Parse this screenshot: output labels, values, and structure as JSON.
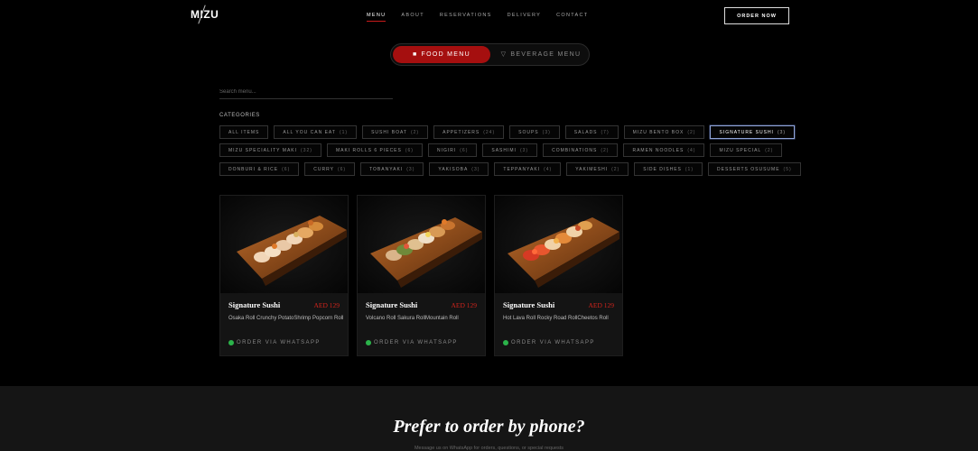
{
  "brand": {
    "logo": "MIZU"
  },
  "nav": {
    "items": [
      "MENU",
      "ABOUT",
      "RESERVATIONS",
      "DELIVERY",
      "CONTACT"
    ],
    "active": "MENU",
    "order_now": "ORDER NOW"
  },
  "menu_toggle": {
    "food_label": "FOOD MENU",
    "beverage_label": "BEVERAGE MENU",
    "active": "FOOD MENU"
  },
  "search": {
    "placeholder": "Search menu...",
    "value": ""
  },
  "categories": {
    "title": "CATEGORIES",
    "rows": [
      [
        {
          "label": "ALL ITEMS",
          "count": ""
        },
        {
          "label": "ALL YOU CAN EAT",
          "count": "(1)"
        },
        {
          "label": "SUSHI BOAT",
          "count": "(2)"
        },
        {
          "label": "APPETIZERS",
          "count": "(24)"
        },
        {
          "label": "SOUPS",
          "count": "(3)"
        },
        {
          "label": "SALADS",
          "count": "(7)"
        },
        {
          "label": "MIZU BENTO BOX",
          "count": "(2)"
        },
        {
          "label": "SIGNATURE SUSHI",
          "count": "(3)"
        }
      ],
      [
        {
          "label": "MIZU SPECIALITY MAKI",
          "count": "(32)"
        },
        {
          "label": "MAKI ROLLS 6 PIECES",
          "count": "(6)"
        },
        {
          "label": "NIGIRI",
          "count": "(6)"
        },
        {
          "label": "SASHIMI",
          "count": "(3)"
        },
        {
          "label": "COMBINATIONS",
          "count": "(2)"
        },
        {
          "label": "RAMEN NOODLES",
          "count": "(4)"
        },
        {
          "label": "MIZU SPECIAL",
          "count": "(2)"
        }
      ],
      [
        {
          "label": "DONBURI & RICE",
          "count": "(6)"
        },
        {
          "label": "CURRY",
          "count": "(6)"
        },
        {
          "label": "TOBANYAKI",
          "count": "(3)"
        },
        {
          "label": "YAKISOBA",
          "count": "(3)"
        },
        {
          "label": "TEPPANYAKI",
          "count": "(4)"
        },
        {
          "label": "YAKIMESHI",
          "count": "(2)"
        },
        {
          "label": "SIDE DISHES",
          "count": "(1)"
        },
        {
          "label": "DESSERTS OSUSUME",
          "count": "(5)"
        }
      ]
    ],
    "active": "SIGNATURE SUSHI"
  },
  "items": [
    {
      "name": "Signature Sushi",
      "price": "AED 129",
      "description": "Osaka Roll Crunchy PotatoShrimp Popcorn Roll",
      "cta": "ORDER VIA WHATSAPP"
    },
    {
      "name": "Signature Sushi",
      "price": "AED 129",
      "description": "Volcano Roll Sakura RollMountain Roll",
      "cta": "ORDER VIA WHATSAPP"
    },
    {
      "name": "Signature Sushi",
      "price": "AED 129",
      "description": "Hot Lava Roll Rocky Road RollCheetos Roll",
      "cta": "ORDER VIA WHATSAPP"
    }
  ],
  "footer_cta": {
    "heading": "Prefer to order by phone?",
    "subtext": "Message us on WhatsApp for orders, questions, or special requests"
  },
  "colors": {
    "accent": "#a50f0f",
    "price": "#d0241c",
    "whatsapp": "#2bb34a",
    "active_chip_border": "#8fa3d6"
  },
  "icons": {
    "food": "bowl-icon",
    "beverage": "glass-icon",
    "whatsapp": "whatsapp-icon"
  }
}
